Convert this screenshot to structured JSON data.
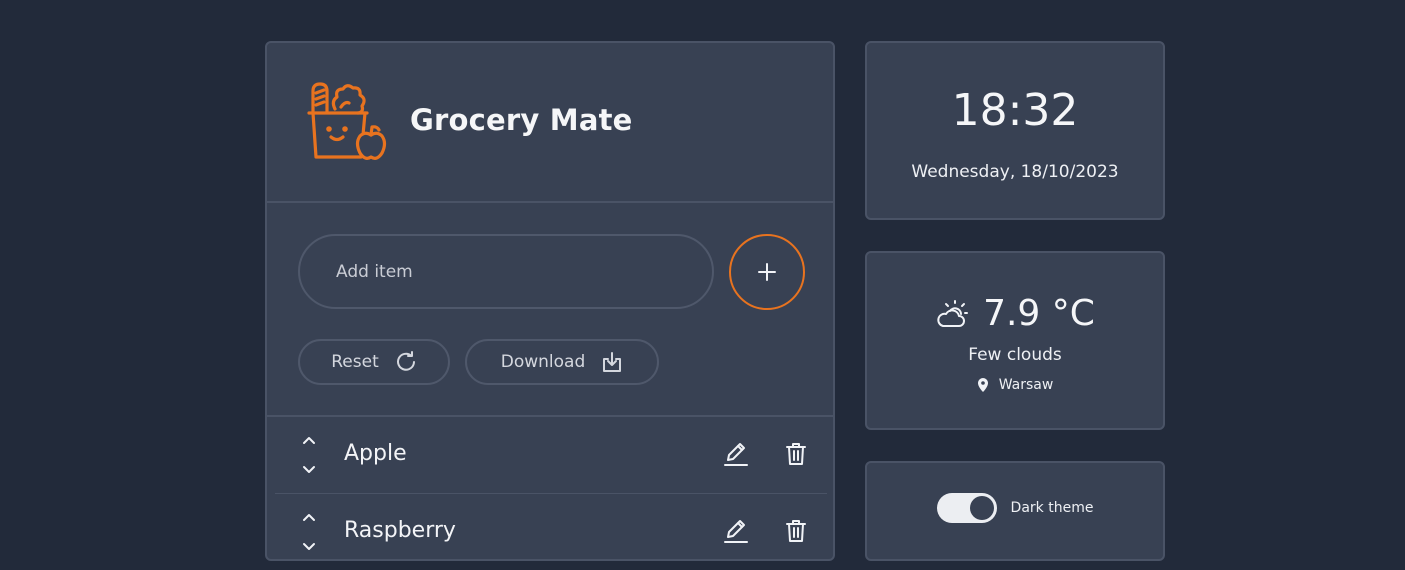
{
  "app": {
    "title": "Grocery Mate"
  },
  "add_item": {
    "placeholder": "Add item",
    "add_button_icon": "plus-icon"
  },
  "actions": {
    "reset_label": "Reset",
    "reset_icon": "refresh-icon",
    "download_label": "Download",
    "download_icon": "download-icon"
  },
  "items": [
    {
      "name": "Apple"
    },
    {
      "name": "Raspberry"
    }
  ],
  "clock": {
    "time": "18:32",
    "date": "Wednesday, 18/10/2023"
  },
  "weather": {
    "temperature": "7.9 °C",
    "description": "Few clouds",
    "location": "Warsaw",
    "icon": "cloud-sun-icon"
  },
  "theme": {
    "label": "Dark theme",
    "enabled": true
  },
  "colors": {
    "accent": "#e8731f",
    "background": "#222a3a",
    "panel": "#384153"
  }
}
